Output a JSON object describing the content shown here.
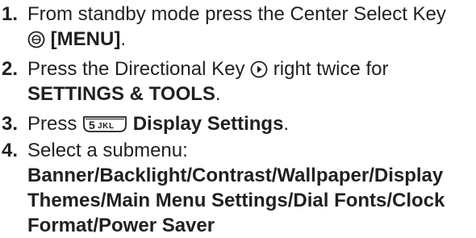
{
  "steps": [
    {
      "number": "1.",
      "text1": "From standby mode press the Center Select Key",
      "key_icon": "center-select-key-icon",
      "key_label": "[MENU]",
      "punct": "."
    },
    {
      "number": "2.",
      "text1": "Press the Directional Key",
      "key_icon": "directional-key-right-icon",
      "text2": "right twice for",
      "bold": "SETTINGS & TOOLS",
      "punct": "."
    },
    {
      "number": "3.",
      "text1": "Press",
      "key_icon": "key-5-jkl-icon",
      "key_text": "5JKL",
      "bold": "Display Settings",
      "punct": "."
    },
    {
      "number": "4.",
      "text1": "Select a submenu:",
      "options_lines": [
        "Banner/Backlight/Contrast/Wallpaper/Display",
        "Themes/Main Menu Settings/Dial Fonts/Clock",
        "Format/Power Saver"
      ]
    }
  ]
}
